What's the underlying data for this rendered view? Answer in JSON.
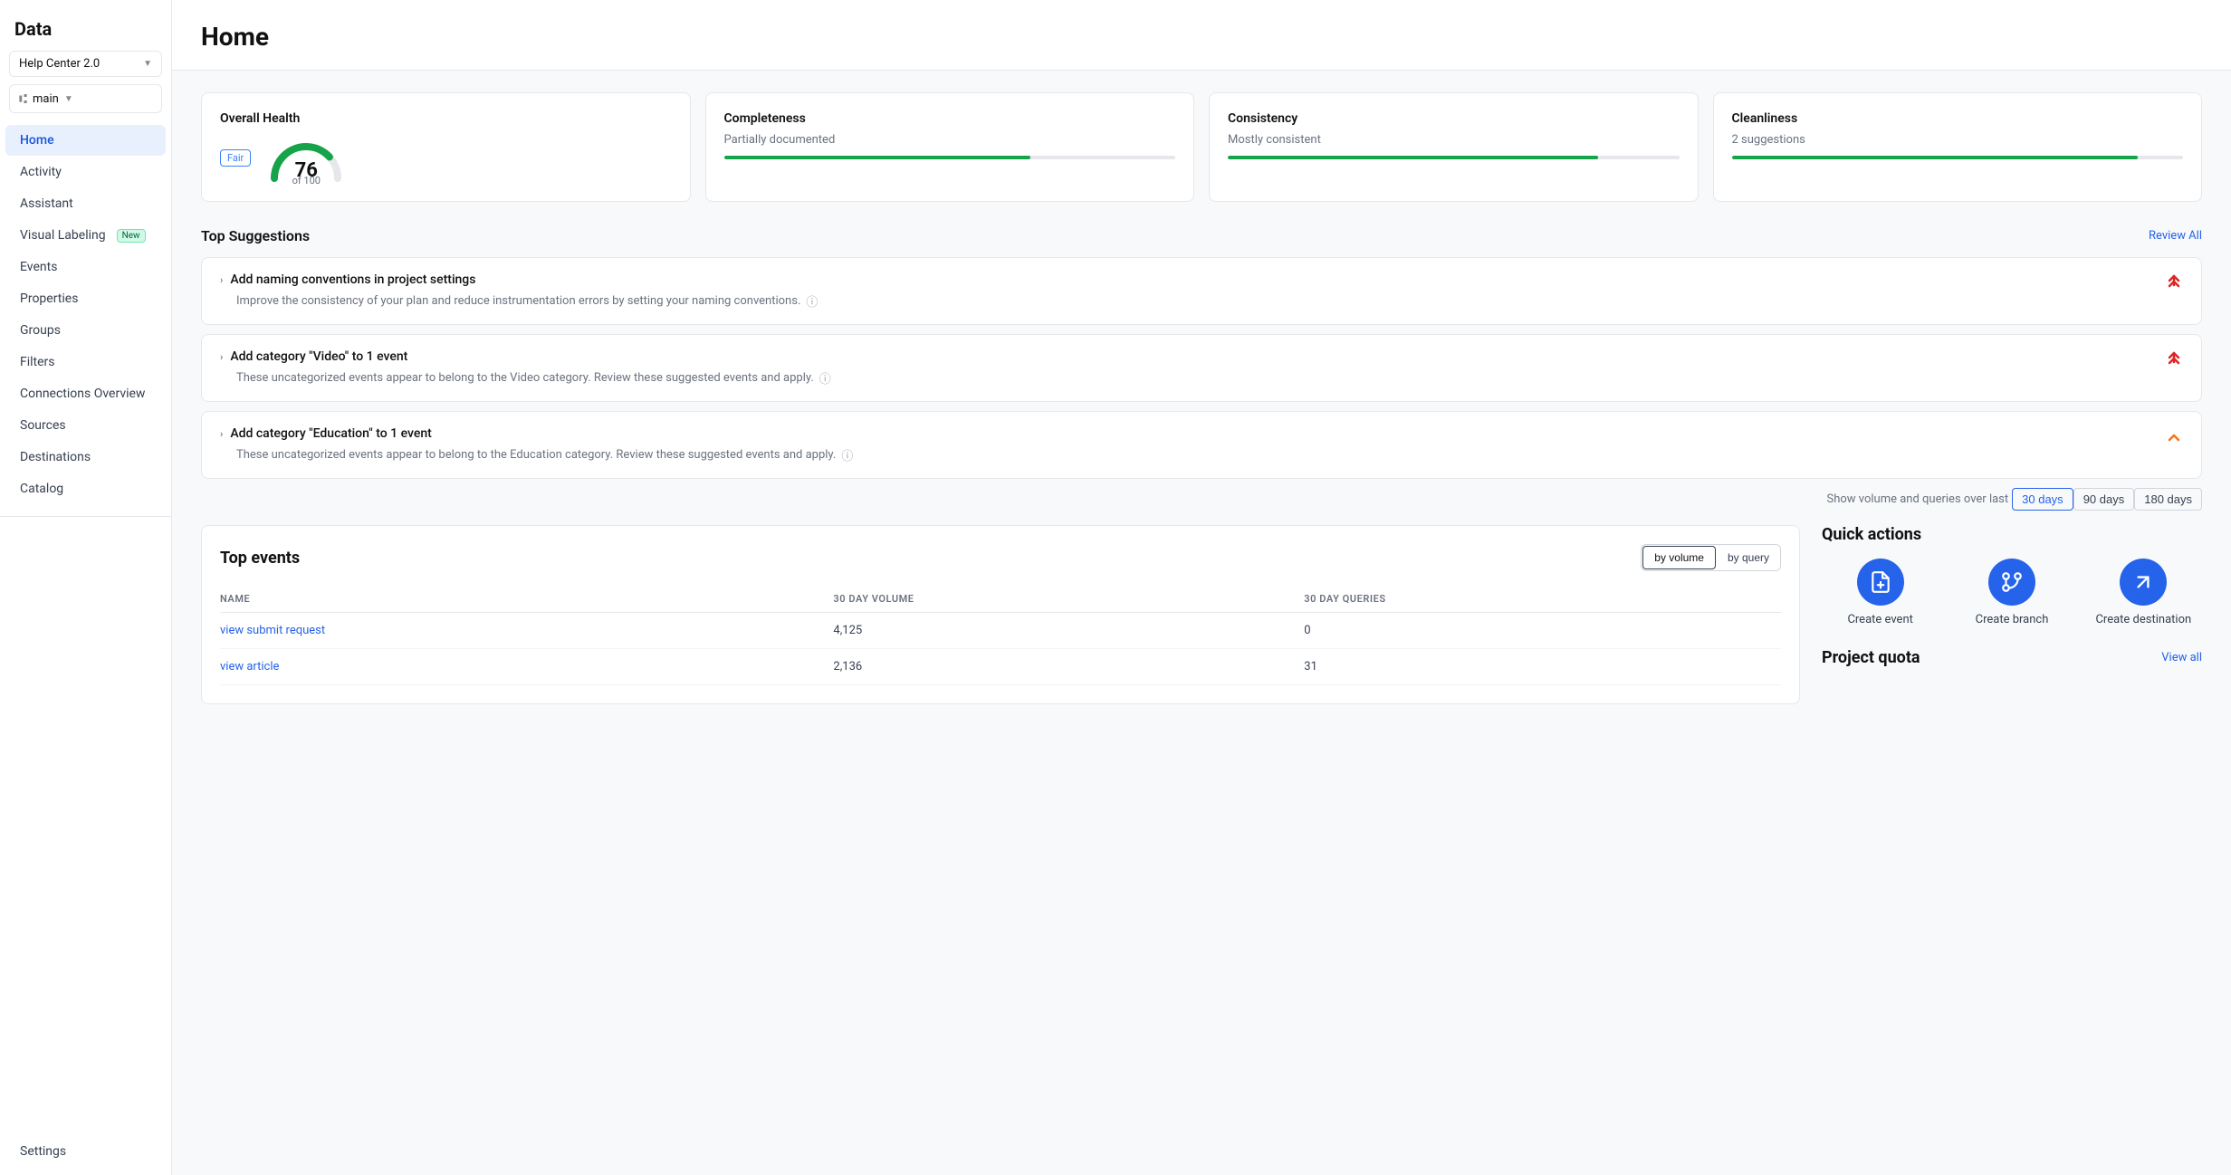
{
  "sidebar": {
    "logo": "Data",
    "workspace": "Help Center 2.0",
    "branch": "main",
    "nav_items": [
      {
        "id": "home",
        "label": "Home",
        "active": true
      },
      {
        "id": "activity",
        "label": "Activity",
        "active": false
      },
      {
        "id": "assistant",
        "label": "Assistant",
        "active": false
      },
      {
        "id": "visual-labeling",
        "label": "Visual Labeling",
        "badge": "New",
        "active": false
      },
      {
        "id": "events",
        "label": "Events",
        "active": false
      },
      {
        "id": "properties",
        "label": "Properties",
        "active": false
      },
      {
        "id": "groups",
        "label": "Groups",
        "active": false
      },
      {
        "id": "filters",
        "label": "Filters",
        "active": false
      },
      {
        "id": "connections-overview",
        "label": "Connections Overview",
        "active": false
      },
      {
        "id": "sources",
        "label": "Sources",
        "active": false
      },
      {
        "id": "destinations",
        "label": "Destinations",
        "active": false
      },
      {
        "id": "catalog",
        "label": "Catalog",
        "active": false
      }
    ],
    "bottom_items": [
      {
        "id": "settings",
        "label": "Settings"
      }
    ]
  },
  "header": {
    "title": "Home"
  },
  "health_cards": [
    {
      "id": "overall-health",
      "title": "Overall Health",
      "score": "76",
      "score_label": "of 100",
      "badge": "Fair",
      "type": "gauge"
    },
    {
      "id": "completeness",
      "title": "Completeness",
      "subtitle": "Partially documented",
      "bar_pct": 68,
      "type": "bar"
    },
    {
      "id": "consistency",
      "title": "Consistency",
      "subtitle": "Mostly consistent",
      "bar_pct": 82,
      "type": "bar"
    },
    {
      "id": "cleanliness",
      "title": "Cleanliness",
      "subtitle": "2 suggestions",
      "bar_pct": 90,
      "type": "bar"
    }
  ],
  "top_suggestions": {
    "section_title": "Top Suggestions",
    "review_all_label": "Review All",
    "items": [
      {
        "id": "suggestion-1",
        "title": "Add naming conventions in project settings",
        "description": "Improve the consistency of your plan and reduce instrumentation errors by setting your naming conventions.",
        "priority": "red"
      },
      {
        "id": "suggestion-2",
        "title": "Add category \"Video\" to 1 event",
        "description": "These uncategorized events appear to belong to the Video category. Review these suggested events and apply.",
        "priority": "red"
      },
      {
        "id": "suggestion-3",
        "title": "Add category \"Education\" to 1 event",
        "description": "These uncategorized events appear to belong to the Education category. Review these suggested events and apply.",
        "priority": "orange"
      }
    ]
  },
  "time_filter": {
    "label": "Show volume and queries over last",
    "options": [
      {
        "id": "30days",
        "label": "30 days",
        "active": true
      },
      {
        "id": "90days",
        "label": "90 days",
        "active": false
      },
      {
        "id": "180days",
        "label": "180 days",
        "active": false
      }
    ]
  },
  "top_events": {
    "section_title": "Top events",
    "view_options": [
      {
        "id": "by-volume",
        "label": "by volume",
        "active": true
      },
      {
        "id": "by-query",
        "label": "by query",
        "active": false
      }
    ],
    "columns": [
      "NAME",
      "30 DAY VOLUME",
      "30 DAY QUERIES"
    ],
    "rows": [
      {
        "name": "view submit request",
        "volume": "4,125",
        "queries": "0"
      },
      {
        "name": "view article",
        "volume": "2,136",
        "queries": "31"
      }
    ]
  },
  "quick_actions": {
    "section_title": "Quick actions",
    "items": [
      {
        "id": "create-event",
        "label": "Create event",
        "icon": "📄"
      },
      {
        "id": "create-branch",
        "label": "Create branch",
        "icon": "🔀"
      },
      {
        "id": "create-destination",
        "label": "Create destination",
        "icon": "↗"
      }
    ]
  },
  "project_quota": {
    "section_title": "Project quota",
    "view_all_label": "View all"
  }
}
